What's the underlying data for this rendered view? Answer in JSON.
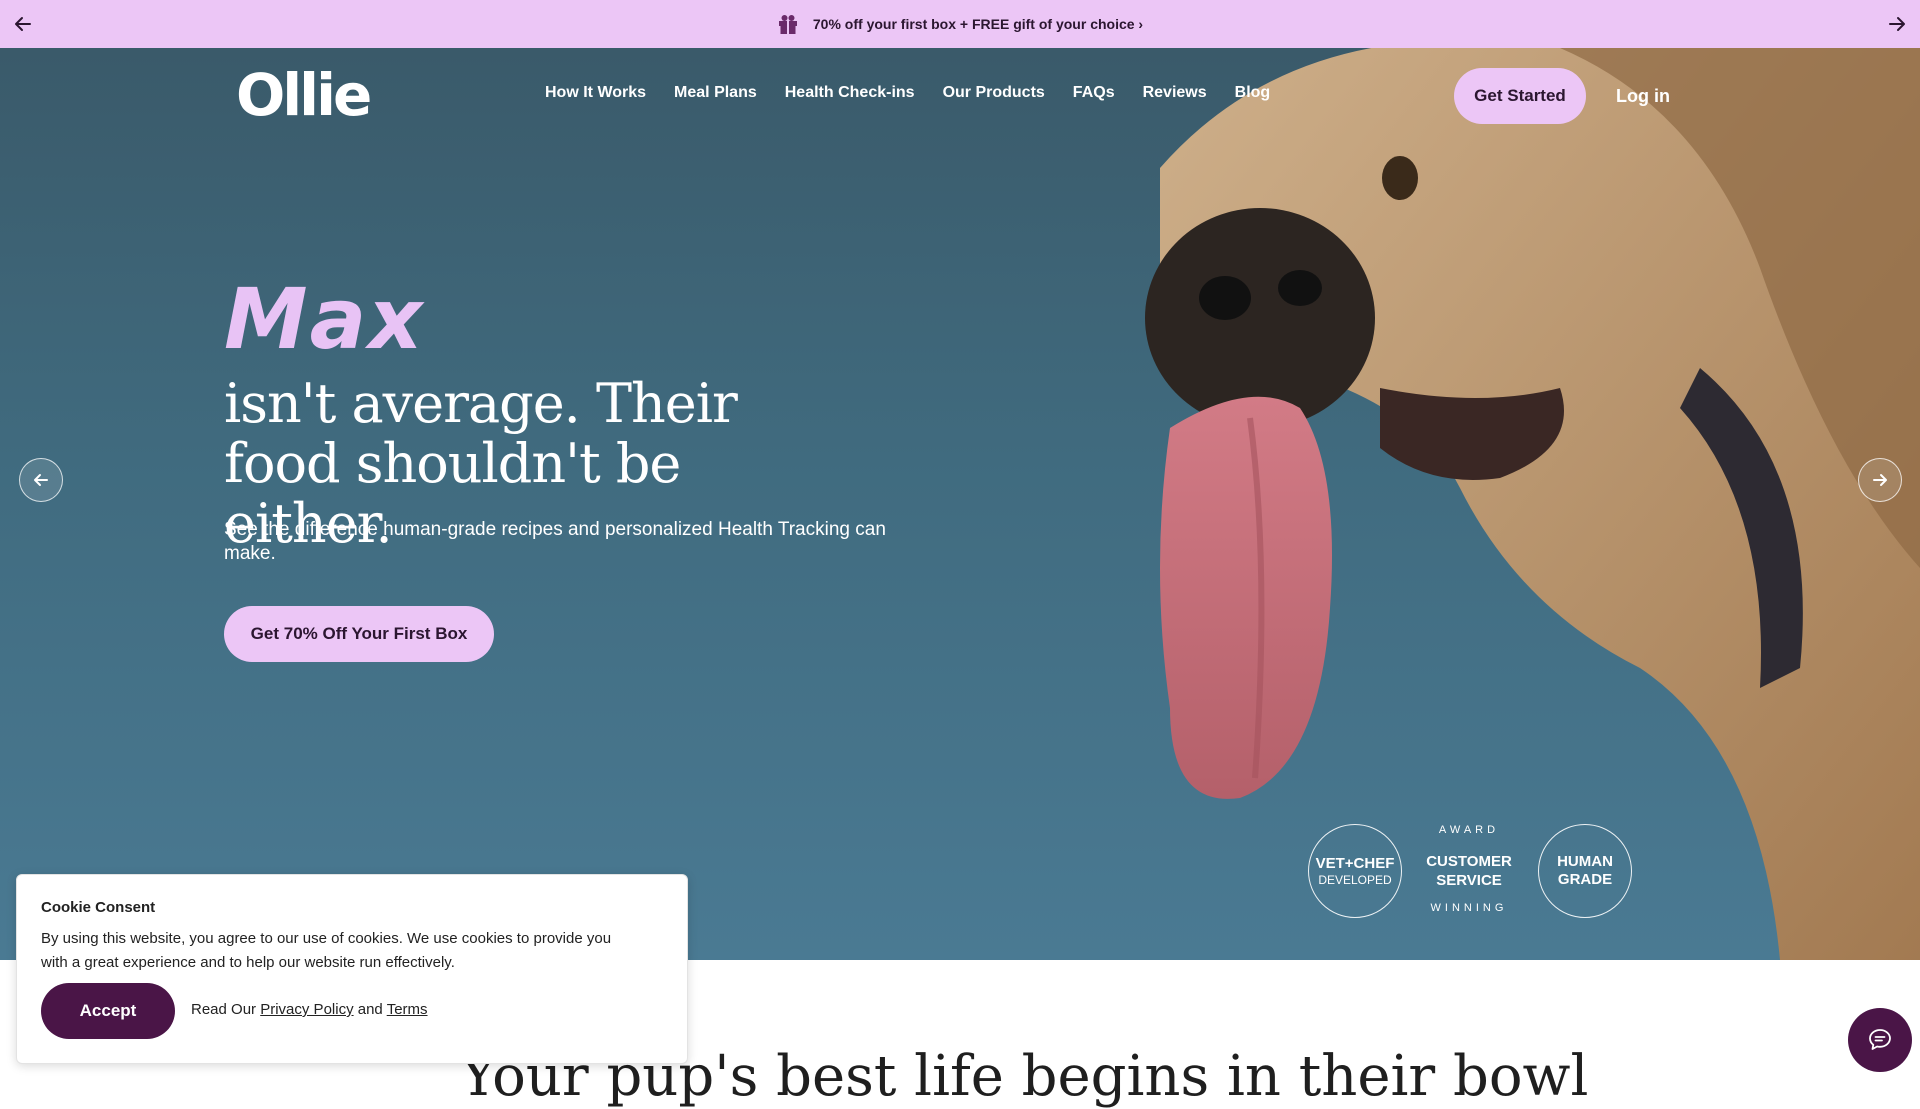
{
  "promo": {
    "text": "70% off your first box + FREE gift of your choice ›",
    "prev_icon": "arrow-left-icon",
    "next_icon": "arrow-right-icon",
    "gift_icon": "gift-icon"
  },
  "brand": {
    "logo": "Ollie"
  },
  "nav": {
    "items": [
      "How It Works",
      "Meal Plans",
      "Health Check-ins",
      "Our Products",
      "FAQs",
      "Reviews",
      "Blog"
    ],
    "get_started": "Get Started",
    "login": "Log in"
  },
  "hero": {
    "pet_name": "Max",
    "headline": "isn't average. Their food shouldn't be either.",
    "subtext": "See the difference human-grade recipes and personalized Health Tracking can make.",
    "cta": "Get 70% Off Your First Box",
    "badges": {
      "vet_chef_big": "VET+CHEF",
      "vet_chef_small": "DEVELOPED",
      "award_top": "AWARD",
      "award_mid": "CUSTOMER SERVICE",
      "award_bot": "WINNING",
      "human_grade": "HUMAN GRADE"
    }
  },
  "section": {
    "title": "Your pup's best life begins in their bowl"
  },
  "cookie": {
    "title": "Cookie Consent",
    "body": "By using this website, you agree to our use of cookies. We use cookies to provide you with a great experience and to help our website run effectively.",
    "accept": "Accept",
    "read_our": "Read Our",
    "privacy": "Privacy Policy",
    "and": "and",
    "terms": "Terms"
  },
  "colors": {
    "banner_bg": "#ecc6f6",
    "accent_pink": "#ecc6f6",
    "brand_purple": "#4a1547",
    "hero_bg": "#406b7f"
  }
}
